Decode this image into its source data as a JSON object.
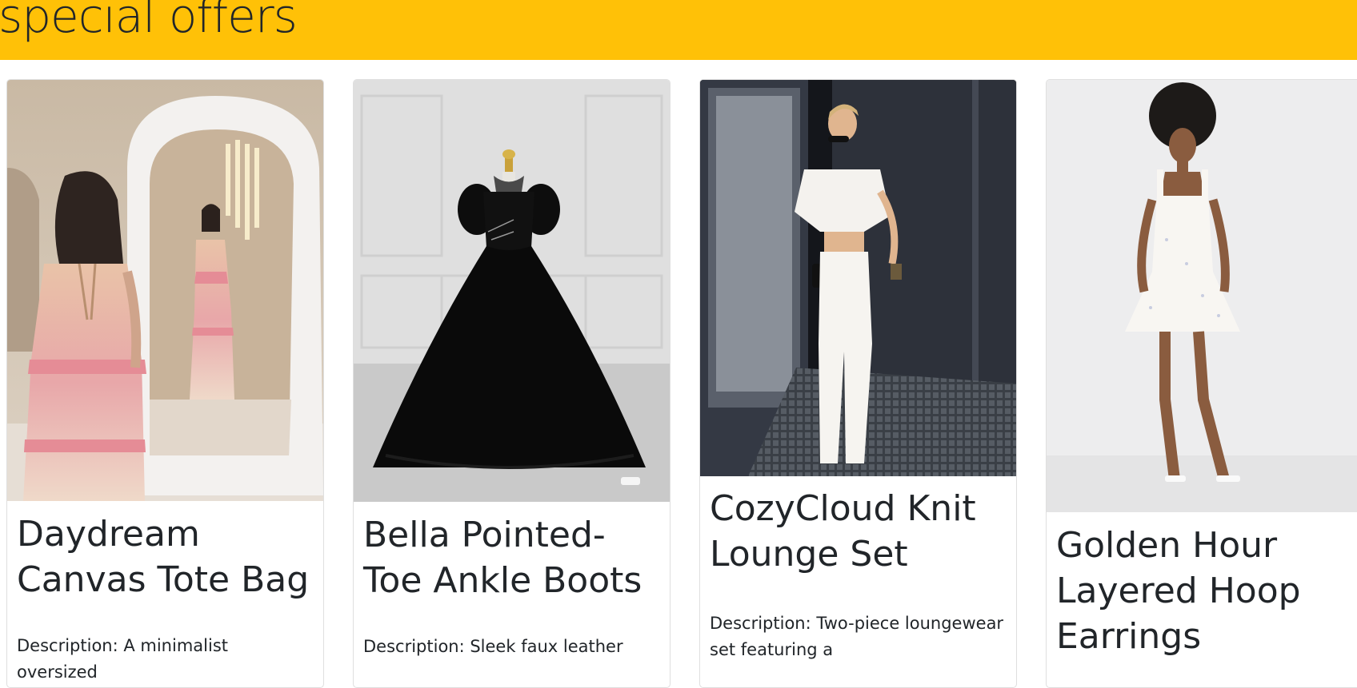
{
  "banner": {
    "title": "special offers"
  },
  "products": [
    {
      "name": "Daydream Canvas Tote Bag",
      "description": "Description: A minimalist oversized",
      "image": "woman-floral-dress-mirror-photo"
    },
    {
      "name": "Bella Pointed-Toe Ankle Boots",
      "description": "Description: Sleek faux leather",
      "image": "black-ballgown-mannequin-photo"
    },
    {
      "name": "CozyCloud Knit Lounge Set",
      "description": "Description: Two-piece loungewear set featuring a",
      "image": "woman-white-outfit-photo"
    },
    {
      "name": "Golden Hour Layered Hoop Earrings",
      "description": "",
      "image": "woman-white-sundress-photo"
    }
  ],
  "colors": {
    "banner": "#ffc107",
    "text": "#212529",
    "card_border": "rgba(0,0,0,0.125)"
  }
}
